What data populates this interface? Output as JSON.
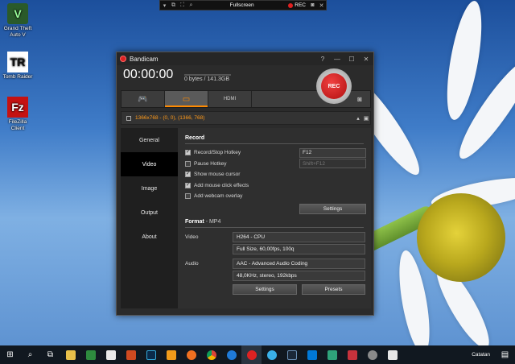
{
  "desktop": {
    "icons": [
      {
        "label": "Grand Theft Auto V",
        "glyph": "V"
      },
      {
        "label": "Tomb Raider",
        "glyph": "TR"
      },
      {
        "label": "FileZilla Client",
        "glyph": "Fz"
      }
    ]
  },
  "capture_bar": {
    "mode": "Fullscreen",
    "rec_label": "REC"
  },
  "window": {
    "title": "Bandicam",
    "help_label": "?",
    "timer": "00:00:00",
    "bytes": "0 bytes / 141.3GB",
    "rec_button": "REC",
    "modes": [
      {
        "name": "game-mode",
        "icon": "gamepad-icon",
        "glyph": "🎮"
      },
      {
        "name": "screen-mode",
        "icon": "screen-rectangle-icon",
        "glyph": "▭"
      },
      {
        "name": "hdmi-mode",
        "icon": "hdmi-icon",
        "glyph": "HDMI"
      }
    ],
    "region": "1366x768 - (0, 0), (1366, 768)",
    "sidebar": [
      "General",
      "Video",
      "Image",
      "Output",
      "About"
    ],
    "active_tab": "Video",
    "record": {
      "title": "Record",
      "options": [
        {
          "label": "Record/Stop Hotkey",
          "checked": true,
          "value": "F12"
        },
        {
          "label": "Pause Hotkey",
          "checked": false,
          "value": "Shift+F12"
        },
        {
          "label": "Show mouse cursor",
          "checked": true
        },
        {
          "label": "Add mouse click effects",
          "checked": true
        },
        {
          "label": "Add webcam overlay",
          "checked": false
        }
      ],
      "settings_button": "Settings"
    },
    "format": {
      "title": "Format",
      "container": "MP4",
      "video_label": "Video",
      "video_codec": "H264 - CPU",
      "video_detail": "Full Size, 60,00fps, 100q",
      "audio_label": "Audio",
      "audio_codec": "AAC - Advanced Audio Coding",
      "audio_detail": "48,0KHz, stereo, 192kbps",
      "settings_button": "Settings",
      "presets_button": "Presets"
    }
  },
  "taskbar": {
    "notes_label": "Catatan"
  }
}
